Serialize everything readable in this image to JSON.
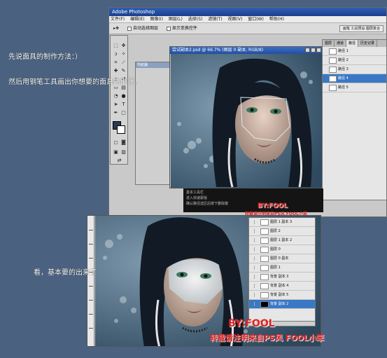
{
  "app": {
    "title": "Adobe Photoshop",
    "menu": [
      "文件(F)",
      "编辑(E)",
      "图像(I)",
      "图层(L)",
      "选择(S)",
      "滤镜(T)",
      "视图(V)",
      "窗口(W)",
      "帮助(H)"
    ],
    "options": {
      "auto_select": "自动选择图层",
      "show_bounds": "显示变换控件",
      "workspace_btn": "画笔 工具预设 图层复合"
    }
  },
  "nav_window": {
    "title": "导航器"
  },
  "doc1": {
    "title": "尝试副本2.psd @ 66.7% (图层 0 副本, RGB/8)"
  },
  "layers1": {
    "tabs": [
      "图层",
      "通道",
      "路径",
      "历史记录"
    ],
    "rows": [
      "路径 1",
      "路径 2",
      "路径 3",
      "路径 4",
      "路径 5"
    ],
    "selected": 3
  },
  "status1": {
    "lines": [
      "基本工具栏",
      "进入快速蒙版",
      "确认路径选区后按下删除键"
    ]
  },
  "layers2": {
    "rows": [
      "图层 1 副本 3",
      "图层 2",
      "图层 1 副本 2",
      "图层 0",
      "图层 0 副本",
      "图层 1",
      "背景 副本 3",
      "背景 副本 4",
      "背景 副本 5",
      "背景 副本 2"
    ],
    "selected": 9
  },
  "notes": {
    "intro": "先说面具的制作方法：）",
    "pen_step": "然后用钢笔工具画出你想要的面具的形状。",
    "result": "看，基本要的出来了"
  },
  "signature": {
    "by": "BY:FOOL",
    "credit": "转载请注明来自PS风  FOOL小笨",
    "small_by": "BY:FOOL",
    "small_credit": "转载请注明来自PS风 FOOL小笨"
  },
  "colors": {
    "background": "#4a6280",
    "signature": "#e02020",
    "selection": "#3a78c6"
  }
}
